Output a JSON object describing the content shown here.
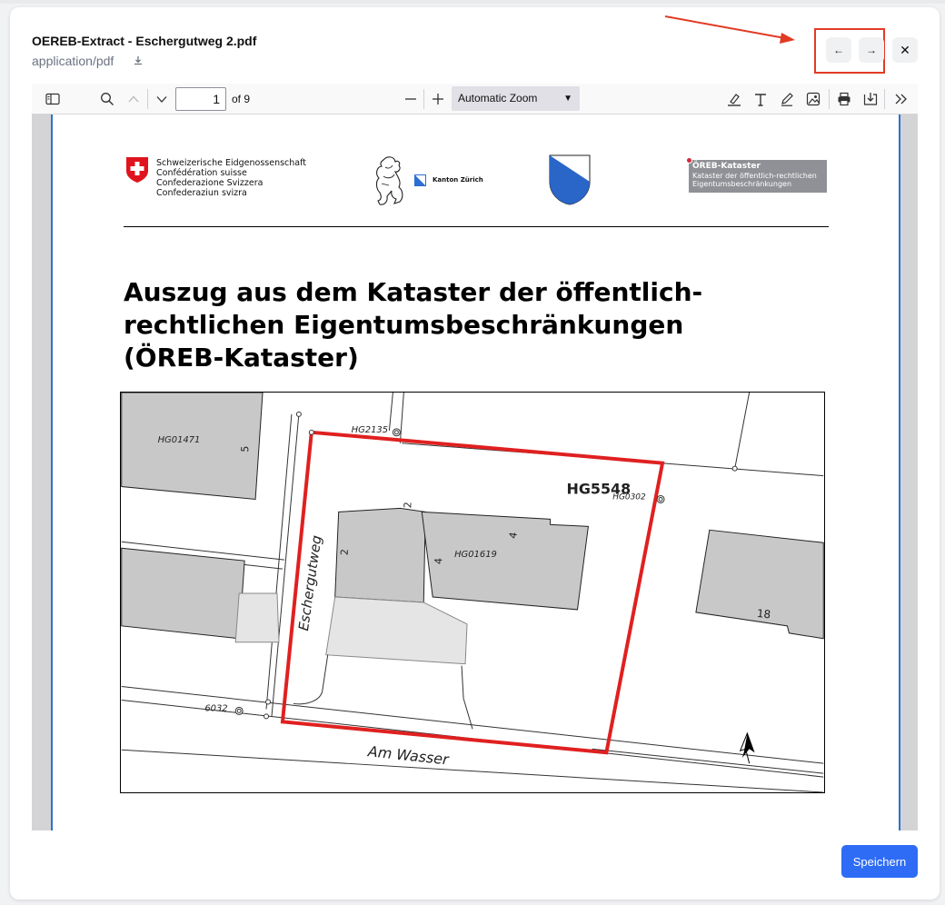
{
  "dialog": {
    "title": "OEREB-Extract - Eschergutweg 2.pdf",
    "mime": "application/pdf",
    "prev_icon": "arrow-left-icon",
    "next_icon": "arrow-right-icon",
    "close_icon": "close-icon",
    "save_label": "Speichern",
    "accent": "#2e6cf6",
    "annotation_color": "#e23b24"
  },
  "viewer": {
    "page_number": "1",
    "page_count": "of 9",
    "zoom": "Automatic Zoom"
  },
  "document": {
    "confederation": [
      "Schweizerische Eidgenossenschaft",
      "Confédération suisse",
      "Confederazione Svizzera",
      "Confederaziun svizra"
    ],
    "kanton": "Kanton Zürich",
    "oreb_logo_title": "ÖREB-Kataster",
    "oreb_logo_line1": "Kataster der öffentlich-rechtlichen",
    "oreb_logo_line2": "Eigentumsbeschränkungen",
    "heading": "Auszug aus dem Kataster der öffentlich-rechtlichen Eigentumsbeschränkungen (ÖREB-Kataster)",
    "map_labels": {
      "parcel": "HG5548",
      "hg0302": "HG0302",
      "hg2135": "HG2135",
      "hg01471": "HG01471",
      "hg01619": "HG01619",
      "p6032": "6032",
      "street1": "Eschergutweg",
      "street2": "Am Wasser",
      "n5": "5",
      "n2a": "2",
      "n2b": "2",
      "n4a": "4",
      "n4b": "4",
      "n18": "18"
    }
  }
}
